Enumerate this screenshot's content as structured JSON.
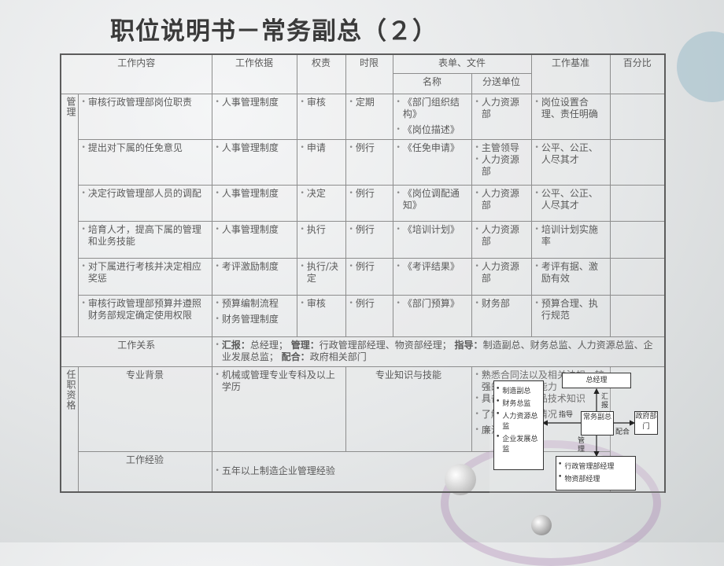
{
  "title": "职位说明书－常务副总（２）",
  "header": {
    "work_content": "工作内容",
    "work_basis": "工作依据",
    "authority": "权责",
    "time_limit": "时限",
    "forms_files": "表单、文件",
    "name": "名称",
    "distribution": "分送单位",
    "work_standard": "工作基准",
    "percentage": "百分比"
  },
  "group_label": "管理",
  "rows": [
    {
      "content": "审核行政管理部岗位职责",
      "basis": [
        "人事管理制度"
      ],
      "authority": "审核",
      "time": "定期",
      "forms": [
        "《部门组织结构》",
        "《岗位描述》"
      ],
      "dist": [
        "人力资源部"
      ],
      "standard": "岗位设置合理、责任明确"
    },
    {
      "content": "提出对下属的任免意见",
      "basis": [
        "人事管理制度"
      ],
      "authority": "申请",
      "time": "例行",
      "forms": [
        "《任免申请》"
      ],
      "dist": [
        "主管领导",
        "人力资源部"
      ],
      "standard": "公平、公正、人尽其才"
    },
    {
      "content": "决定行政管理部人员的调配",
      "basis": [
        "人事管理制度"
      ],
      "authority": "决定",
      "time": "例行",
      "forms": [
        "《岗位调配通知》"
      ],
      "dist": [
        "人力资源部"
      ],
      "standard": "公平、公正、人尽其才"
    },
    {
      "content": "培育人才，提高下属的管理和业务技能",
      "basis": [
        "人事管理制度"
      ],
      "authority": "执行",
      "time": "例行",
      "forms": [
        "《培训计划》"
      ],
      "dist": [
        "人力资源部"
      ],
      "standard": "培训计划实施率"
    },
    {
      "content": "对下属进行考核并决定相应奖惩",
      "basis": [
        "考评激励制度"
      ],
      "authority": "执行/决定",
      "time": "例行",
      "forms": [
        "《考评结果》"
      ],
      "dist": [
        "人力资源部"
      ],
      "standard": "考评有据、激励有效"
    },
    {
      "content": "审核行政管理部预算并遵照财务部规定确定使用权限",
      "basis": [
        "预算编制流程",
        "财务管理制度"
      ],
      "authority": "审核",
      "time": "例行",
      "forms": [
        "《部门预算》"
      ],
      "dist": [
        "财务部"
      ],
      "standard": "预算合理、执行规范"
    }
  ],
  "relations": {
    "label": "工作关系",
    "report_label": "汇报：",
    "report_text": "总经理；",
    "manage_label": "管理：",
    "manage_text": "行政管理部经理、物资部经理；",
    "guide_label": "指导：",
    "guide_text": "制造副总、财务总监、人力资源总监、企业发展总监；",
    "coop_label": "配合：",
    "coop_text": "政府相关部门"
  },
  "qualification": {
    "label": "任职资格",
    "background_label": "专业背景",
    "background_text": "机械或管理专业专科及以上学历",
    "knowledge_label": "专业知识与技能",
    "knowledge_items": [
      "熟悉合同法以及相关法规、较强的商务谈判能力",
      "具备相当的产品技术知识",
      "了解企业实际情况",
      "廉洁奉公"
    ],
    "experience_label": "工作经验",
    "experience_text": "五年以上制造企业管理经验"
  },
  "org_chart": {
    "top": "总经理",
    "center": "常务副总",
    "right": "政府部门",
    "left_items": [
      "制造副总",
      "财务总监",
      "人力资源总监",
      "企业发展总监"
    ],
    "bottom_items": [
      "行政管理部经理",
      "物资部经理"
    ],
    "label_report": "汇报",
    "label_guide": "指导",
    "label_coop": "配合",
    "label_manage": "管理"
  },
  "colors": {
    "text": "#5a5a5a",
    "title": "#3a3a3a",
    "border": "#8d8d8d"
  }
}
